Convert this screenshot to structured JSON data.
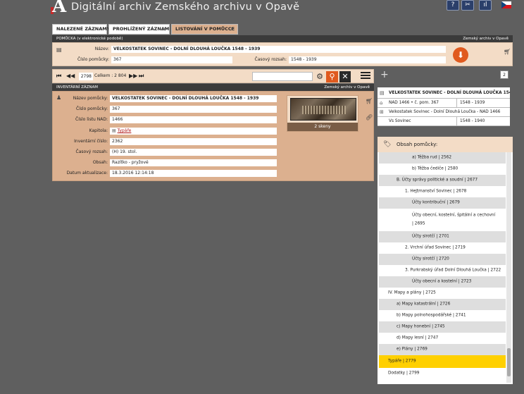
{
  "header": {
    "logo_text": "A",
    "title": "Digitální archiv  Zemského archivu v Opavě"
  },
  "tabs": [
    {
      "label": "NALEZENÉ ZÁZNAMY"
    },
    {
      "label": "PROHLÍŽENÝ ZÁZNAM"
    },
    {
      "label": "LISTOVÁNÍ V POMŮCCE"
    }
  ],
  "pomucka": {
    "head_left": "POMŮCKA (v elektronické podobě)",
    "head_right": "Zemský archiv v Opavě",
    "nazev_label": "Název:",
    "nazev_value": "VELKOSTATEK SOVINEC - DOLNÍ DLOUHÁ LOUČKA 1548 - 1939",
    "cislo_label": "Číslo pomůcky:",
    "cislo_value": "367",
    "rozsah_label": "Časový rozsah:",
    "rozsah_value": "1548 - 1939"
  },
  "nav": {
    "page": "2798",
    "celkem": "Celkem : 2 804"
  },
  "inventar": {
    "head_left": "INVENTÁRNÍ ZÁZNAM",
    "head_right": "Zemský archiv v Opavě",
    "fields": [
      {
        "label": "Název pomůcky:",
        "value": "VELKOSTATEK SOVINEC - DOLNÍ DLOUHÁ LOUČKA 1548 - 1939"
      },
      {
        "label": "Číslo pomůcky:",
        "value": "367"
      },
      {
        "label": "Číslo listu NAD:",
        "value": "1466"
      },
      {
        "label": "Kapitola:",
        "value": "Typáře"
      },
      {
        "label": "Inventární číslo:",
        "value": "2362"
      },
      {
        "label": "Časový rozsah:",
        "value": "(H) 19. stol."
      },
      {
        "label": "Obsah:",
        "value": "Razítko - pryžové"
      },
      {
        "label": "Datum aktualizace:",
        "value": "18.3.2016 12:14:18"
      }
    ],
    "thumb_caption": "2 skeny"
  },
  "right": {
    "count": "2",
    "records": [
      {
        "c1": "VELKOSTATEK SOVINEC - DOLNÍ DLOUHÁ LOUČKA 1548 - ...",
        "c2": ""
      },
      {
        "c1": "NAD 1466 • č. pom. 367",
        "c2": "1548 - 1939"
      },
      {
        "c1": "Velkostatek Sovinec - Dolní Dlouhá Loučka - NAD 1466",
        "c2": ""
      },
      {
        "c1": "Vs Sovinec",
        "c2": "1548 - 1940"
      }
    ]
  },
  "obsah": {
    "title": "Obsah pomůcky:",
    "items": [
      {
        "text": "a) Těžba rud | 2562"
      },
      {
        "text": "b) Těžba čediče | 2580"
      },
      {
        "text": "B. Účty správy politické a soudní | 2677"
      },
      {
        "text": "1. Hejtmanství Sovinec | 2678"
      },
      {
        "text": "Účty kontribuční | 2679"
      },
      {
        "text": "Účty obecní, kostelní, špitální a cechovní"
      },
      {
        "text": "| 2695"
      },
      {
        "text": "Účty sirotčí | 2701"
      },
      {
        "text": "2. Vrchní úřad Sovinec | 2719"
      },
      {
        "text": "Účty sirotčí | 2720"
      },
      {
        "text": "3. Purkrabský úřad Dolní Dlouhá Loučka | 2722"
      },
      {
        "text": "Účty obecní a kostelní | 2723"
      },
      {
        "text": "IV. Mapy a plány | 2725"
      },
      {
        "text": "a) Mapy katastrální | 2726"
      },
      {
        "text": "b) Mapy polnohospodářské | 2741"
      },
      {
        "text": "c) Mapy honební | 2745"
      },
      {
        "text": "d) Mapy lesní | 2747"
      },
      {
        "text": "e) Plány | 2769"
      },
      {
        "text": "Typáře | 2779"
      },
      {
        "text": "Dodatky | 2799"
      }
    ]
  },
  "colors": {
    "accent": "#e05a1e",
    "panel": "#f3dcc6",
    "panel_dark": "#dcb08f",
    "selected": "#ffd000",
    "background": "#5f5f5f"
  }
}
